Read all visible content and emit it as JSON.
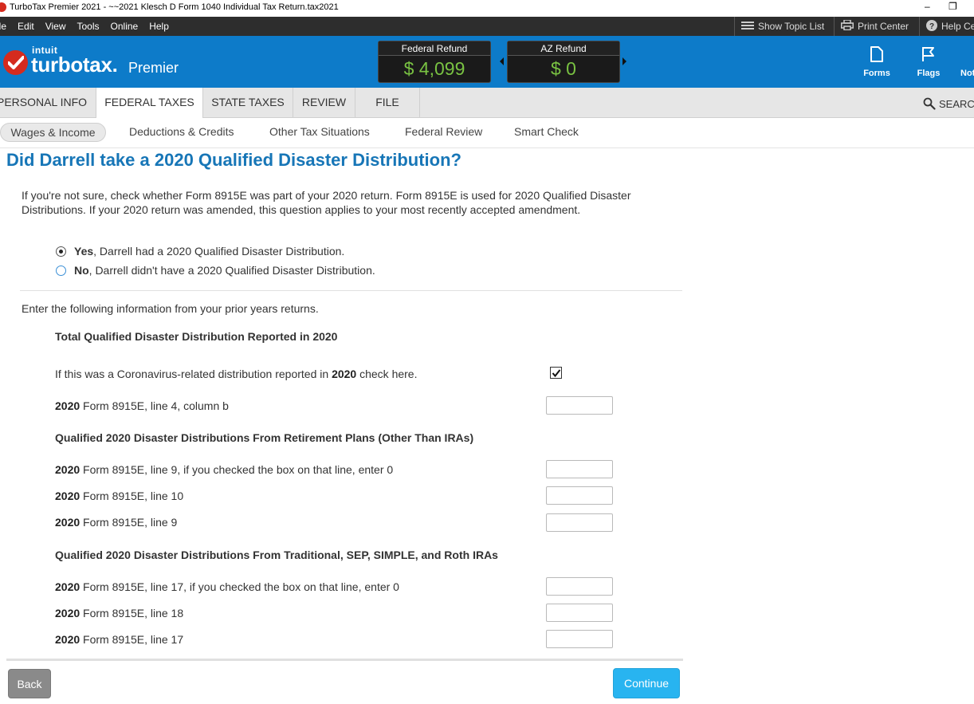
{
  "window": {
    "title": "TurboTax Premier 2021 - ~~2021 Klesch D Form 1040  Individual Tax Return.tax2021",
    "minimize": "–",
    "restore": "❐"
  },
  "menu": {
    "items": [
      "ile",
      "Edit",
      "View",
      "Tools",
      "Online",
      "Help"
    ],
    "show_topic_list": "Show Topic List",
    "print_center": "Print Center",
    "help_center": "Help Ce"
  },
  "brand": {
    "intuit": "intuit",
    "name": "turbotax.",
    "edition": "Premier"
  },
  "refunds": [
    {
      "label": "Federal Refund",
      "amount": "$ 4,099"
    },
    {
      "label": "AZ Refund",
      "amount": "$ 0"
    }
  ],
  "header_tools": {
    "forms": "Forms",
    "flags": "Flags",
    "notes": "Not"
  },
  "nav": {
    "tabs": [
      "PERSONAL INFO",
      "FEDERAL TAXES",
      "STATE TAXES",
      "REVIEW",
      "FILE"
    ],
    "search": "SEARC"
  },
  "subnav": {
    "tabs": [
      "Wages & Income",
      "Deductions & Credits",
      "Other Tax Situations",
      "Federal Review",
      "Smart Check"
    ]
  },
  "page": {
    "title": "Did Darrell take a 2020 Qualified Disaster Distribution?",
    "intro": "If you're not sure, check whether Form 8915E was part of your 2020 return. Form 8915E is used for 2020 Qualified Disaster Distributions. If your 2020 return was amended, this question applies to your most recently accepted amendment.",
    "radio_yes_bold": "Yes",
    "radio_yes_rest": ", Darrell had a 2020 Qualified Disaster Distribution.",
    "radio_no_bold": "No",
    "radio_no_rest": ", Darrell didn't have a 2020 Qualified Disaster Distribution.",
    "lead": "Enter the following information from your prior years returns.",
    "section1": "Total Qualified Disaster Distribution Reported in 2020",
    "coronavirus_pre": "If this was a Coronavirus-related distribution reported in ",
    "coronavirus_year": "2020",
    "coronavirus_post": " check here.",
    "section2": "Qualified 2020 Disaster Distributions From Retirement Plans (Other Than IRAs)",
    "section3": "Qualified 2020 Disaster Distributions From Traditional, SEP, SIMPLE, and Roth IRAs",
    "year": "2020",
    "fields": {
      "line4": {
        "text": " Form 8915E, line 4, column b",
        "value": ""
      },
      "line9_checked": {
        "text": " Form 8915E, line 9, if you checked the box on that line, enter 0",
        "value": ""
      },
      "line10": {
        "text": " Form 8915E, line 10",
        "value": ""
      },
      "line9": {
        "text": " Form 8915E, line 9",
        "value": ""
      },
      "line17_checked": {
        "text": " Form 8915E, line 17, if you checked the box on that line, enter 0",
        "value": ""
      },
      "line18": {
        "text": " Form 8915E, line 18",
        "value": ""
      },
      "line17": {
        "text": " Form 8915E, line 17",
        "value": ""
      }
    }
  },
  "buttons": {
    "back": "Back",
    "continue": "Continue"
  },
  "colors": {
    "brand_blue": "#0d7bc9",
    "title_blue": "#1776b7",
    "refund_green": "#79c242",
    "continue_blue": "#28b4f0",
    "turbotax_red": "#d52b1e"
  }
}
